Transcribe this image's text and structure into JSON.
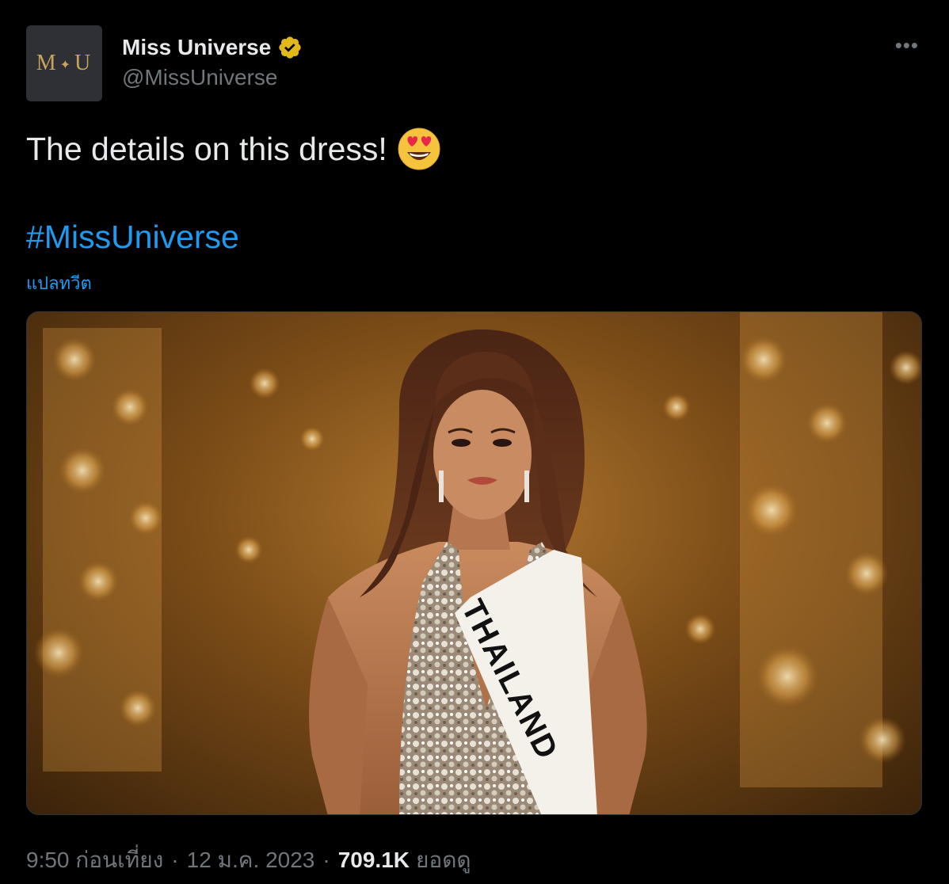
{
  "author": {
    "display_name": "Miss Universe",
    "handle": "@MissUniverse",
    "avatar_text": "M✦U",
    "verified_icon": "verified-gold-badge"
  },
  "tweet": {
    "text": "The details on this dress!",
    "emoji": "smiling-face-with-heart-eyes",
    "hashtag": "#MissUniverse",
    "translate_label": "แปลทวีต"
  },
  "media": {
    "sash_text": "THAILAND"
  },
  "meta": {
    "time": "9:50 ก่อนเที่ยง",
    "date": "12 ม.ค. 2023",
    "separator": "·",
    "views_count": "709.1K",
    "views_label": "ยอดดู"
  },
  "more_icon": "more-options-icon",
  "colors": {
    "background": "#000000",
    "text": "#e7e9ea",
    "muted": "#71767b",
    "link": "#1d9bf0",
    "verified": "#e2b719"
  }
}
